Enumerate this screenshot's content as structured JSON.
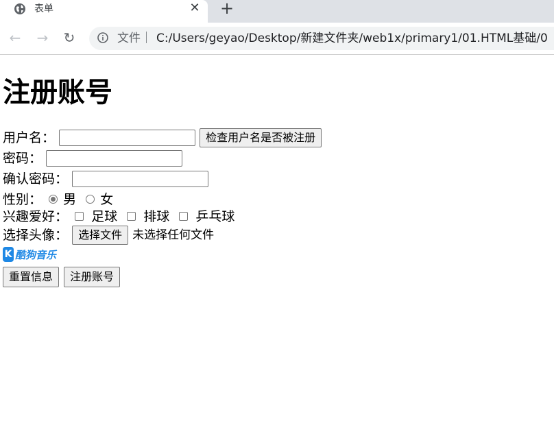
{
  "browser": {
    "tab_title": "表单",
    "tab_close": "✕",
    "new_tab": "+",
    "back": "←",
    "forward": "→",
    "reload": "↻",
    "address_file_label": "文件｜",
    "address_url": "C:/Users/geyao/Desktop/新建文件夹/web1x/primary1/01.HTML基础/0"
  },
  "page": {
    "heading": "注册账号",
    "username": {
      "label": "用户名：",
      "value": "",
      "check_button": "检查用户名是否被注册"
    },
    "password": {
      "label": "密码：",
      "value": ""
    },
    "confirm_password": {
      "label": "确认密码：",
      "value": ""
    },
    "gender": {
      "label": "性别：",
      "options": [
        "男",
        "女"
      ],
      "selected": "男"
    },
    "hobbies": {
      "label": "兴趣爱好：",
      "options": [
        "足球",
        "排球",
        "乒乓球"
      ]
    },
    "avatar": {
      "label": "选择头像：",
      "button": "选择文件",
      "hint": "未选择任何文件"
    },
    "logo": {
      "mark": "K",
      "text": "酷狗音乐"
    },
    "buttons": {
      "reset": "重置信息",
      "submit": "注册账号"
    }
  },
  "colors": {
    "tabstrip": "#dee1e6",
    "omnibox": "#f1f3f4",
    "logo_blue": "#1e88e5"
  }
}
